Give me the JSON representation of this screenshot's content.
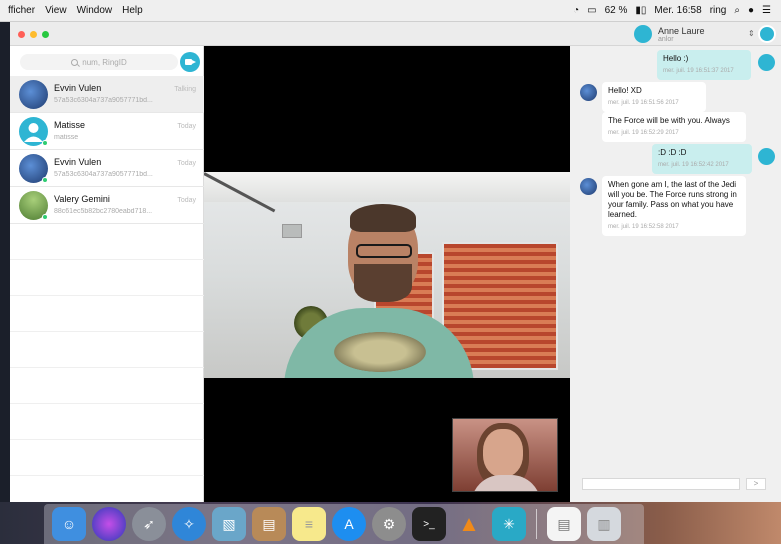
{
  "menubar": {
    "app_name": "fficher",
    "menus": [
      "View",
      "Window",
      "Help"
    ],
    "battery": "62 %",
    "clock": "Mer. 16:58",
    "user": "ring"
  },
  "account": {
    "name": "Anne Laure",
    "sub": "anlor"
  },
  "sidebar": {
    "search_placeholder": "num, RingID",
    "contacts": [
      {
        "name": "Evvin Vulen",
        "sub": "57a53c6304a737a9057771bd...",
        "time": "Talking",
        "avatar_color": "#2b4d8a"
      },
      {
        "name": "Matisse",
        "sub": "matisse",
        "time": "Today",
        "avatar_color": "#2eb5d3"
      },
      {
        "name": "Evvin Vulen",
        "sub": "57a53c6304a737a9057771bd...",
        "time": "Today",
        "avatar_color": "#2b4d8a"
      },
      {
        "name": "Valery Gemini",
        "sub": "88c61ec5b82bc2780eabd718...",
        "time": "Today",
        "avatar_color": "#7fa85a"
      }
    ]
  },
  "chat": {
    "messages": [
      {
        "text": "Hello :)",
        "stamp": "mer. juil. 19 16:51:37 2017",
        "dir": "out"
      },
      {
        "text": "Hello! XD",
        "stamp": "mer. juil. 19 16:51:56 2017",
        "dir": "in"
      },
      {
        "text": "The Force will be with you. Always",
        "stamp": "mer. juil. 19 16:52:29 2017",
        "dir": "in"
      },
      {
        "text": ":D :D :D",
        "stamp": "mer. juil. 19 16:52:42 2017",
        "dir": "out"
      },
      {
        "text": "When gone am I, the last of the Jedi will you be. The Force runs strong in your family. Pass on what you have learned.",
        "stamp": "mer. juil. 19 16:52:58 2017",
        "dir": "in"
      }
    ],
    "send_label": ">"
  },
  "colors": {
    "accent": "#2eb5d3",
    "outgoing_bubble": "#c9eeee",
    "presence": "#2ecc71"
  },
  "dock": {
    "icons": [
      "finder-icon",
      "siri-icon",
      "launchpad-icon",
      "safari-icon",
      "preview-icon",
      "contacts-icon",
      "notes-icon",
      "app-store-icon",
      "system-preferences-icon",
      "terminal-icon",
      "vlc-icon",
      "ring-icon",
      "file-icon",
      "trash-icon"
    ]
  }
}
